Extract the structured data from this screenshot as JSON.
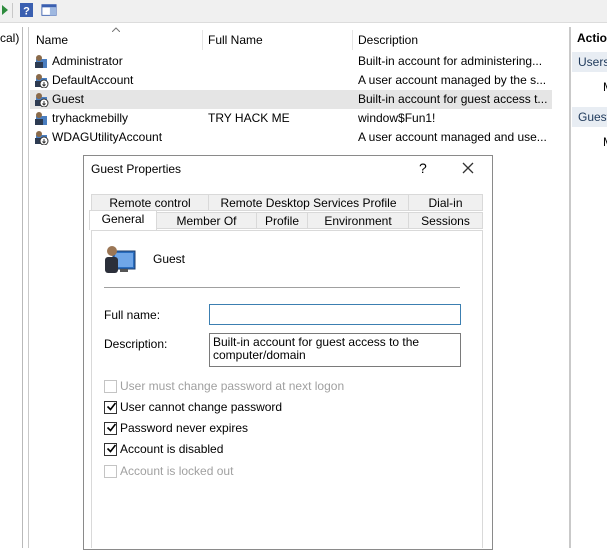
{
  "left_pane": {
    "tree_text": "cal)"
  },
  "list": {
    "headers": {
      "name": "Name",
      "full_name": "Full Name",
      "description": "Description"
    },
    "rows": [
      {
        "name": "Administrator",
        "full_name": "",
        "description": "Built-in account for administering..."
      },
      {
        "name": "DefaultAccount",
        "full_name": "",
        "description": "A user account managed by the s..."
      },
      {
        "name": "Guest",
        "full_name": "",
        "description": "Built-in account for guest access t..."
      },
      {
        "name": "tryhackmebilly",
        "full_name": "TRY HACK ME",
        "description": "window$Fun1!"
      },
      {
        "name": "WDAGUtilityAccount",
        "full_name": "",
        "description": "A user account managed and use..."
      }
    ]
  },
  "actions": {
    "title": "Actio",
    "sections": [
      {
        "label": "Users",
        "item": "M"
      },
      {
        "label": "Guest",
        "item": "M"
      }
    ]
  },
  "dialog": {
    "title": "Guest Properties",
    "help": "?",
    "tabs_row1": [
      "Remote control",
      "Remote Desktop Services Profile",
      "Dial-in"
    ],
    "tabs_row2": [
      "General",
      "Member Of",
      "Profile",
      "Environment",
      "Sessions"
    ],
    "user_name": "Guest",
    "full_name_label": "Full name:",
    "full_name_value": "",
    "description_label": "Description:",
    "description_value": "Built-in account for guest access to the computer/domain",
    "checkboxes": [
      {
        "label": "User must change password at next logon",
        "checked": false,
        "disabled": true
      },
      {
        "label": "User cannot change password",
        "checked": true,
        "disabled": false
      },
      {
        "label": "Password never expires",
        "checked": true,
        "disabled": false
      },
      {
        "label": "Account is disabled",
        "checked": true,
        "disabled": false
      },
      {
        "label": "Account is locked out",
        "checked": false,
        "disabled": true
      }
    ]
  }
}
